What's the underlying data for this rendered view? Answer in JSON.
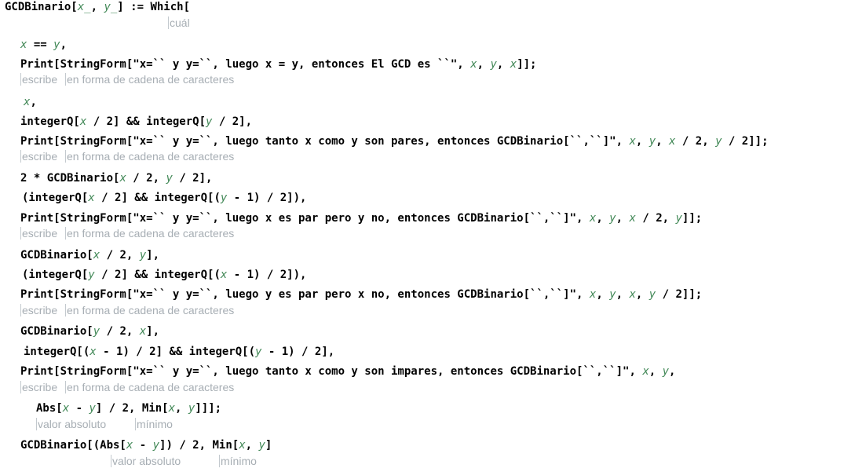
{
  "code_lines": [
    {
      "name": "line-definition",
      "segs": [
        {
          "t": "GCDBinario["
        },
        {
          "t": "x_",
          "v": true
        },
        {
          "t": ", "
        },
        {
          "t": "y_",
          "v": true
        },
        {
          "t": "] := Which["
        }
      ]
    },
    {
      "name": "line-case1-condition",
      "segs": [
        {
          "t": "x",
          "v": true
        },
        {
          "t": " == "
        },
        {
          "t": "y",
          "v": true
        },
        {
          "t": ","
        }
      ]
    },
    {
      "name": "line-case1-print",
      "segs": [
        {
          "t": "Print[StringForm[\"x=`` y y=``, luego x = y, entonces El GCD es ``\", "
        },
        {
          "t": "x",
          "v": true
        },
        {
          "t": ", "
        },
        {
          "t": "y",
          "v": true
        },
        {
          "t": ", "
        },
        {
          "t": "x",
          "v": true
        },
        {
          "t": "]];"
        }
      ]
    },
    {
      "name": "line-case1-result",
      "segs": [
        {
          "t": "x",
          "v": true
        },
        {
          "t": ","
        }
      ]
    },
    {
      "name": "line-case2-condition",
      "segs": [
        {
          "t": "integerQ["
        },
        {
          "t": "x",
          "v": true
        },
        {
          "t": " / 2] && integerQ["
        },
        {
          "t": "y",
          "v": true
        },
        {
          "t": " / 2],"
        }
      ]
    },
    {
      "name": "line-case2-print",
      "segs": [
        {
          "t": "Print[StringForm[\"x=`` y y=``, luego tanto x como y son pares, entonces GCDBinario[``,``]\", "
        },
        {
          "t": "x",
          "v": true
        },
        {
          "t": ", "
        },
        {
          "t": "y",
          "v": true
        },
        {
          "t": ", "
        },
        {
          "t": "x",
          "v": true
        },
        {
          "t": " / 2, "
        },
        {
          "t": "y",
          "v": true
        },
        {
          "t": " / 2]];"
        }
      ]
    },
    {
      "name": "line-case2-result",
      "segs": [
        {
          "t": "2 * GCDBinario["
        },
        {
          "t": "x",
          "v": true
        },
        {
          "t": " / 2, "
        },
        {
          "t": "y",
          "v": true
        },
        {
          "t": " / 2],"
        }
      ]
    },
    {
      "name": "line-case3-condition",
      "segs": [
        {
          "t": "(integerQ["
        },
        {
          "t": "x",
          "v": true
        },
        {
          "t": " / 2] && integerQ[("
        },
        {
          "t": "y",
          "v": true
        },
        {
          "t": " - 1) / 2]),"
        }
      ]
    },
    {
      "name": "line-case3-print",
      "segs": [
        {
          "t": "Print[StringForm[\"x=`` y y=``, luego x es par pero y no, entonces GCDBinario[``,``]\", "
        },
        {
          "t": "x",
          "v": true
        },
        {
          "t": ", "
        },
        {
          "t": "y",
          "v": true
        },
        {
          "t": ", "
        },
        {
          "t": "x",
          "v": true
        },
        {
          "t": " / 2, "
        },
        {
          "t": "y",
          "v": true
        },
        {
          "t": "]];"
        }
      ]
    },
    {
      "name": "line-case3-result",
      "segs": [
        {
          "t": "GCDBinario["
        },
        {
          "t": "x",
          "v": true
        },
        {
          "t": " / 2, "
        },
        {
          "t": "y",
          "v": true
        },
        {
          "t": "],"
        }
      ]
    },
    {
      "name": "line-case4-condition",
      "segs": [
        {
          "t": "(integerQ["
        },
        {
          "t": "y",
          "v": true
        },
        {
          "t": " / 2] && integerQ[("
        },
        {
          "t": "x",
          "v": true
        },
        {
          "t": " - 1) / 2]),"
        }
      ]
    },
    {
      "name": "line-case4-print",
      "segs": [
        {
          "t": "Print[StringForm[\"x=`` y y=``, luego y es par pero x no, entonces GCDBinario[``,``]\", "
        },
        {
          "t": "x",
          "v": true
        },
        {
          "t": ", "
        },
        {
          "t": "y",
          "v": true
        },
        {
          "t": ", "
        },
        {
          "t": "x",
          "v": true
        },
        {
          "t": ", "
        },
        {
          "t": "y",
          "v": true
        },
        {
          "t": " / 2]];"
        }
      ]
    },
    {
      "name": "line-case4-result",
      "segs": [
        {
          "t": "GCDBinario["
        },
        {
          "t": "y",
          "v": true
        },
        {
          "t": " / 2, "
        },
        {
          "t": "x",
          "v": true
        },
        {
          "t": "],"
        }
      ]
    },
    {
      "name": "line-case5-condition",
      "segs": [
        {
          "t": "integerQ[("
        },
        {
          "t": "x",
          "v": true
        },
        {
          "t": " - 1) / 2] && integerQ[("
        },
        {
          "t": "y",
          "v": true
        },
        {
          "t": " - 1) / 2],"
        }
      ]
    },
    {
      "name": "line-case5-print",
      "segs": [
        {
          "t": "Print[StringForm[\"x=`` y y=``, luego tanto x como y son impares, entonces GCDBinario[``,``]\", "
        },
        {
          "t": "x",
          "v": true
        },
        {
          "t": ", "
        },
        {
          "t": "y",
          "v": true
        },
        {
          "t": ","
        }
      ]
    },
    {
      "name": "line-case5-print-cont",
      "segs": [
        {
          "t": "Abs["
        },
        {
          "t": "x",
          "v": true
        },
        {
          "t": " - "
        },
        {
          "t": "y",
          "v": true
        },
        {
          "t": "] / 2, Min["
        },
        {
          "t": "x",
          "v": true
        },
        {
          "t": ", "
        },
        {
          "t": "y",
          "v": true
        },
        {
          "t": "]]];"
        }
      ]
    },
    {
      "name": "line-case5-result",
      "segs": [
        {
          "t": "GCDBinario[(Abs["
        },
        {
          "t": "x",
          "v": true
        },
        {
          "t": " - "
        },
        {
          "t": "y",
          "v": true
        },
        {
          "t": "]) / 2, Min["
        },
        {
          "t": "x",
          "v": true
        },
        {
          "t": ", "
        },
        {
          "t": "y",
          "v": true
        },
        {
          "t": "]"
        }
      ]
    }
  ],
  "hints": [
    {
      "name": "hint-which",
      "text": "cuál"
    },
    {
      "name": "hint-print",
      "text": "escribe"
    },
    {
      "name": "hint-stringform",
      "text": "en forma de cadena de caracteres"
    },
    {
      "name": "hint-print",
      "text": "escribe"
    },
    {
      "name": "hint-stringform",
      "text": "en forma de cadena de caracteres"
    },
    {
      "name": "hint-print",
      "text": "escribe"
    },
    {
      "name": "hint-stringform",
      "text": "en forma de cadena de caracteres"
    },
    {
      "name": "hint-print",
      "text": "escribe"
    },
    {
      "name": "hint-stringform",
      "text": "en forma de cadena de caracteres"
    },
    {
      "name": "hint-print",
      "text": "escribe"
    },
    {
      "name": "hint-stringform",
      "text": "en forma de cadena de caracteres"
    },
    {
      "name": "hint-abs",
      "text": "valor absoluto"
    },
    {
      "name": "hint-min",
      "text": "mínimo"
    },
    {
      "name": "hint-abs",
      "text": "valor absoluto"
    },
    {
      "name": "hint-min",
      "text": "mínimo"
    }
  ],
  "colors": {
    "variable": "#438958",
    "hint": "#a7aeb4",
    "code": "#000000"
  }
}
